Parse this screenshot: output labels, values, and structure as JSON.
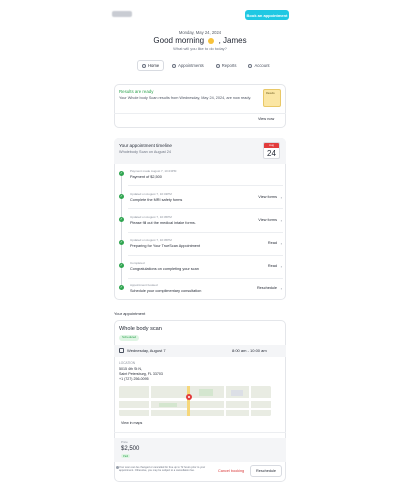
{
  "header": {
    "book_button": "Book an appointment",
    "date": "Monday, May 24, 2024",
    "greeting_prefix": "Good morning",
    "greeting_name": ", James",
    "subtitle": "What will you like to do today?"
  },
  "nav": {
    "tabs": [
      {
        "label": "Home",
        "icon": "home-icon"
      },
      {
        "label": "Appointments",
        "icon": "calendar-icon"
      },
      {
        "label": "Reports",
        "icon": "reports-icon"
      },
      {
        "label": "Account",
        "icon": "account-icon"
      }
    ]
  },
  "results": {
    "title": "Results are ready",
    "text": "Your Whole body Scan results from Wednesday, May 24, 2024, are now ready.",
    "folder_label": "Results",
    "view_now": "View now"
  },
  "timeline": {
    "title": "Your appointment timeline",
    "subtitle": "Wholebody Scan on August 24",
    "cal_month": "Aug",
    "cal_day": "24",
    "steps": [
      {
        "meta": "Payment made August 7, 10:23PM",
        "text": "Payment of $2,500",
        "action": ""
      },
      {
        "meta": "Updated on August 7, 10:43PM",
        "text": "Complete the MRI safety forms",
        "action": "View forms"
      },
      {
        "meta": "Updated on August 7, 10:45PM",
        "text": "Please fill out the medical intake forms.",
        "action": "View forms"
      },
      {
        "meta": "Updated on August 7, 10:45PM",
        "text": "Preparing for Your TrueScan Appointment",
        "action": "Read"
      },
      {
        "meta": "Completed",
        "text": "Congratulations on completing your scan",
        "action": "Read"
      },
      {
        "meta": "Appointment booked",
        "text": "Schedule your complimentary consultation",
        "action": "Reschedule"
      }
    ]
  },
  "appointment": {
    "section_label": "Your appointment",
    "title": "Whole body scan",
    "status": "Scheduled",
    "date": "Wednesday, August 7",
    "time": "8:00 am - 10:00 am",
    "location_label": "LOCATION",
    "address_line1": "5015 4th St N,",
    "address_line2": "Saint Petersburg, FL 33703",
    "phone": "+1 (727) 256-0095",
    "view_maps": "View in maps",
    "price_label": "Price",
    "price": "$2,500",
    "paid": "Paid",
    "note": "Your scan can be changed or cancelled for free up to 72 hours prior to your appointment. Otherwise, you may be subject to a cancellation fee.",
    "cancel": "Cancel booking",
    "reschedule": "Reschedule"
  },
  "colors": {
    "accent": "#1fc8e3",
    "success": "#2ea44f",
    "danger": "#d93636"
  }
}
